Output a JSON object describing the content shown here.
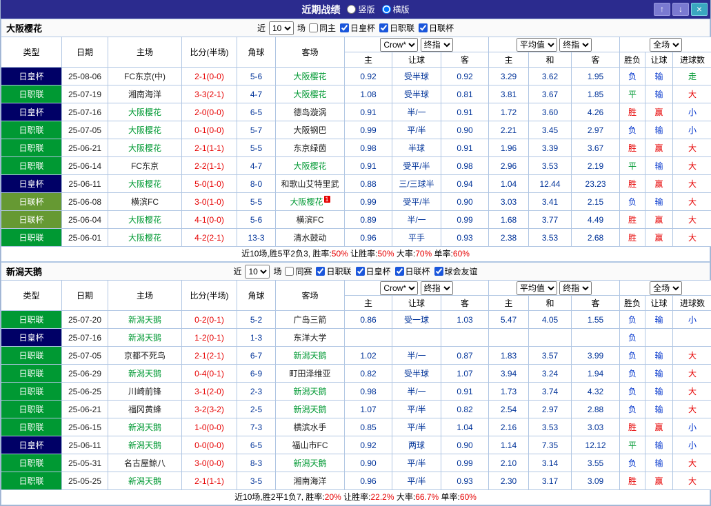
{
  "topbar": {
    "title": "近期战绩",
    "vertical_label": "竖版",
    "horizontal_label": "横版",
    "selected_layout": "横版",
    "up_icon": "↑",
    "down_icon": "↓",
    "close_icon": "×",
    "colors": {
      "bar_bg": "#2b2b8e",
      "button_bg": "#7a7ad1",
      "close_bg": "#3aa7c0"
    }
  },
  "labels": {
    "recent": "近",
    "matches": "场"
  },
  "table": {
    "col_type": "类型",
    "col_date": "日期",
    "col_home": "主场",
    "col_score": "比分(半场)",
    "col_corner": "角球",
    "col_away": "客场",
    "odds_company": "Crow*",
    "odds_final": "终指",
    "avg_label": "平均值",
    "avg_final": "终指",
    "scope": "全场",
    "sub": [
      "主",
      "让球",
      "客",
      "主",
      "和",
      "客",
      "胜负",
      "让球",
      "进球数"
    ]
  },
  "legend_colors": {
    "win": "#e60000",
    "draw": "#009933",
    "lose": "#0033cc",
    "league_j1": "#009933",
    "league_emperor": "#000066",
    "league_levain": "#669933",
    "focal_team": "#009933"
  },
  "sections": [
    {
      "team": "大阪樱花",
      "recent_count": "10",
      "checkboxes": [
        {
          "label": "同主",
          "checked": false
        },
        {
          "label": "日皇杯",
          "checked": true
        },
        {
          "label": "日职联",
          "checked": true
        },
        {
          "label": "日联杯",
          "checked": true
        }
      ],
      "rows": [
        {
          "league": "日皇杯",
          "date": "25-08-06",
          "home": "FC东京(中)",
          "home_focal": false,
          "score": "2-1(0-0)",
          "corner": "5-6",
          "away": "大阪樱花",
          "away_focal": true,
          "away_badge": "",
          "odds": [
            "0.92",
            "受半球",
            "0.92"
          ],
          "avg": [
            "3.29",
            "3.62",
            "1.95"
          ],
          "result": "负",
          "handicap_result": "输",
          "goals_result": "走"
        },
        {
          "league": "日职联",
          "date": "25-07-19",
          "home": "湘南海洋",
          "home_focal": false,
          "score": "3-3(2-1)",
          "corner": "4-7",
          "away": "大阪樱花",
          "away_focal": true,
          "away_badge": "",
          "odds": [
            "1.08",
            "受半球",
            "0.81"
          ],
          "avg": [
            "3.81",
            "3.67",
            "1.85"
          ],
          "result": "平",
          "handicap_result": "输",
          "goals_result": "大"
        },
        {
          "league": "日皇杯",
          "date": "25-07-16",
          "home": "大阪樱花",
          "home_focal": true,
          "score": "2-0(0-0)",
          "corner": "6-5",
          "away": "德岛漩涡",
          "away_focal": false,
          "away_badge": "",
          "odds": [
            "0.91",
            "半/一",
            "0.91"
          ],
          "avg": [
            "1.72",
            "3.60",
            "4.26"
          ],
          "result": "胜",
          "handicap_result": "赢",
          "goals_result": "小"
        },
        {
          "league": "日职联",
          "date": "25-07-05",
          "home": "大阪樱花",
          "home_focal": true,
          "score": "0-1(0-0)",
          "corner": "5-7",
          "away": "大阪钢巴",
          "away_focal": false,
          "away_badge": "",
          "odds": [
            "0.99",
            "平/半",
            "0.90"
          ],
          "avg": [
            "2.21",
            "3.45",
            "2.97"
          ],
          "result": "负",
          "handicap_result": "输",
          "goals_result": "小"
        },
        {
          "league": "日职联",
          "date": "25-06-21",
          "home": "大阪樱花",
          "home_focal": true,
          "score": "2-1(1-1)",
          "corner": "5-5",
          "away": "东京绿茵",
          "away_focal": false,
          "away_badge": "",
          "odds": [
            "0.98",
            "半球",
            "0.91"
          ],
          "avg": [
            "1.96",
            "3.39",
            "3.67"
          ],
          "result": "胜",
          "handicap_result": "赢",
          "goals_result": "大"
        },
        {
          "league": "日职联",
          "date": "25-06-14",
          "home": "FC东京",
          "home_focal": false,
          "score": "2-2(1-1)",
          "corner": "4-7",
          "away": "大阪樱花",
          "away_focal": true,
          "away_badge": "",
          "odds": [
            "0.91",
            "受平/半",
            "0.98"
          ],
          "avg": [
            "2.96",
            "3.53",
            "2.19"
          ],
          "result": "平",
          "handicap_result": "输",
          "goals_result": "大"
        },
        {
          "league": "日皇杯",
          "date": "25-06-11",
          "home": "大阪樱花",
          "home_focal": true,
          "score": "5-0(1-0)",
          "corner": "8-0",
          "away": "和歌山艾特里武",
          "away_focal": false,
          "away_badge": "",
          "odds": [
            "0.88",
            "三/三球半",
            "0.94"
          ],
          "avg": [
            "1.04",
            "12.44",
            "23.23"
          ],
          "result": "胜",
          "handicap_result": "赢",
          "goals_result": "大"
        },
        {
          "league": "日联杯",
          "date": "25-06-08",
          "home": "横滨FC",
          "home_focal": false,
          "score": "3-0(1-0)",
          "corner": "5-5",
          "away": "大阪樱花",
          "away_focal": true,
          "away_badge": "1",
          "odds": [
            "0.99",
            "受平/半",
            "0.90"
          ],
          "avg": [
            "3.03",
            "3.41",
            "2.15"
          ],
          "result": "负",
          "handicap_result": "输",
          "goals_result": "大"
        },
        {
          "league": "日联杯",
          "date": "25-06-04",
          "home": "大阪樱花",
          "home_focal": true,
          "score": "4-1(0-0)",
          "corner": "5-6",
          "away": "横滨FC",
          "away_focal": false,
          "away_badge": "",
          "odds": [
            "0.89",
            "半/一",
            "0.99"
          ],
          "avg": [
            "1.68",
            "3.77",
            "4.49"
          ],
          "result": "胜",
          "handicap_result": "赢",
          "goals_result": "大"
        },
        {
          "league": "日职联",
          "date": "25-06-01",
          "home": "大阪樱花",
          "home_focal": true,
          "score": "4-2(2-1)",
          "corner": "13-3",
          "away": "清水鼓动",
          "away_focal": false,
          "away_badge": "",
          "odds": [
            "0.96",
            "平手",
            "0.93"
          ],
          "avg": [
            "2.38",
            "3.53",
            "2.68"
          ],
          "result": "胜",
          "handicap_result": "赢",
          "goals_result": "大"
        }
      ],
      "summary": [
        {
          "text": "近10场,胜5平2负3, 胜率:",
          "red": false
        },
        {
          "text": "50%",
          "red": true
        },
        {
          "text": " 让胜率:",
          "red": false
        },
        {
          "text": "50%",
          "red": true
        },
        {
          "text": " 大率:",
          "red": false
        },
        {
          "text": "70%",
          "red": true
        },
        {
          "text": " 单率:",
          "red": false
        },
        {
          "text": "60%",
          "red": true
        }
      ]
    },
    {
      "team": "新潟天鹅",
      "recent_count": "10",
      "checkboxes": [
        {
          "label": "同赛",
          "checked": false
        },
        {
          "label": "日职联",
          "checked": true
        },
        {
          "label": "日皇杯",
          "checked": true
        },
        {
          "label": "日联杯",
          "checked": true
        },
        {
          "label": "球会友谊",
          "checked": true
        }
      ],
      "rows": [
        {
          "league": "日职联",
          "date": "25-07-20",
          "home": "新潟天鹅",
          "home_focal": true,
          "score": "0-2(0-1)",
          "corner": "5-2",
          "away": "广岛三箭",
          "away_focal": false,
          "away_badge": "",
          "odds": [
            "0.86",
            "受一球",
            "1.03"
          ],
          "avg": [
            "5.47",
            "4.05",
            "1.55"
          ],
          "result": "负",
          "handicap_result": "输",
          "goals_result": "小"
        },
        {
          "league": "日皇杯",
          "date": "25-07-16",
          "home": "新潟天鹅",
          "home_focal": true,
          "score": "1-2(0-1)",
          "corner": "1-3",
          "away": "东洋大学",
          "away_focal": false,
          "away_badge": "",
          "odds": [
            "",
            "",
            ""
          ],
          "avg": [
            "",
            "",
            ""
          ],
          "result": "负",
          "handicap_result": "",
          "goals_result": ""
        },
        {
          "league": "日职联",
          "date": "25-07-05",
          "home": "京都不死鸟",
          "home_focal": false,
          "score": "2-1(2-1)",
          "corner": "6-7",
          "away": "新潟天鹅",
          "away_focal": true,
          "away_badge": "",
          "odds": [
            "1.02",
            "半/一",
            "0.87"
          ],
          "avg": [
            "1.83",
            "3.57",
            "3.99"
          ],
          "result": "负",
          "handicap_result": "输",
          "goals_result": "大"
        },
        {
          "league": "日职联",
          "date": "25-06-29",
          "home": "新潟天鹅",
          "home_focal": true,
          "score": "0-4(0-1)",
          "corner": "6-9",
          "away": "町田泽维亚",
          "away_focal": false,
          "away_badge": "",
          "odds": [
            "0.82",
            "受半球",
            "1.07"
          ],
          "avg": [
            "3.94",
            "3.24",
            "1.94"
          ],
          "result": "负",
          "handicap_result": "输",
          "goals_result": "大"
        },
        {
          "league": "日职联",
          "date": "25-06-25",
          "home": "川崎前锋",
          "home_focal": false,
          "score": "3-1(2-0)",
          "corner": "2-3",
          "away": "新潟天鹅",
          "away_focal": true,
          "away_badge": "",
          "odds": [
            "0.98",
            "半/一",
            "0.91"
          ],
          "avg": [
            "1.73",
            "3.74",
            "4.32"
          ],
          "result": "负",
          "handicap_result": "输",
          "goals_result": "大"
        },
        {
          "league": "日职联",
          "date": "25-06-21",
          "home": "福冈黄蜂",
          "home_focal": false,
          "score": "3-2(3-2)",
          "corner": "2-5",
          "away": "新潟天鹅",
          "away_focal": true,
          "away_badge": "",
          "odds": [
            "1.07",
            "平/半",
            "0.82"
          ],
          "avg": [
            "2.54",
            "2.97",
            "2.88"
          ],
          "result": "负",
          "handicap_result": "输",
          "goals_result": "大"
        },
        {
          "league": "日职联",
          "date": "25-06-15",
          "home": "新潟天鹅",
          "home_focal": true,
          "score": "1-0(0-0)",
          "corner": "7-3",
          "away": "横滨水手",
          "away_focal": false,
          "away_badge": "",
          "odds": [
            "0.85",
            "平/半",
            "1.04"
          ],
          "avg": [
            "2.16",
            "3.53",
            "3.03"
          ],
          "result": "胜",
          "handicap_result": "赢",
          "goals_result": "小"
        },
        {
          "league": "日皇杯",
          "date": "25-06-11",
          "home": "新潟天鹅",
          "home_focal": true,
          "score": "0-0(0-0)",
          "corner": "6-5",
          "away": "福山市FC",
          "away_focal": false,
          "away_badge": "",
          "odds": [
            "0.92",
            "两球",
            "0.90"
          ],
          "avg": [
            "1.14",
            "7.35",
            "12.12"
          ],
          "result": "平",
          "handicap_result": "输",
          "goals_result": "小"
        },
        {
          "league": "日职联",
          "date": "25-05-31",
          "home": "名古屋鲸八",
          "home_focal": false,
          "score": "3-0(0-0)",
          "corner": "8-3",
          "away": "新潟天鹅",
          "away_focal": true,
          "away_badge": "",
          "odds": [
            "0.90",
            "平/半",
            "0.99"
          ],
          "avg": [
            "2.10",
            "3.14",
            "3.55"
          ],
          "result": "负",
          "handicap_result": "输",
          "goals_result": "大"
        },
        {
          "league": "日职联",
          "date": "25-05-25",
          "home": "新潟天鹅",
          "home_focal": true,
          "score": "2-1(1-1)",
          "corner": "3-5",
          "away": "湘南海洋",
          "away_focal": false,
          "away_badge": "",
          "odds": [
            "0.96",
            "平/半",
            "0.93"
          ],
          "avg": [
            "2.30",
            "3.17",
            "3.09"
          ],
          "result": "胜",
          "handicap_result": "赢",
          "goals_result": "大"
        }
      ],
      "summary": [
        {
          "text": "近10场,胜2平1负7, 胜率:",
          "red": false
        },
        {
          "text": "20%",
          "red": true
        },
        {
          "text": " 让胜率:",
          "red": false
        },
        {
          "text": "22.2%",
          "red": true
        },
        {
          "text": " 大率:",
          "red": false
        },
        {
          "text": "66.7%",
          "red": true
        },
        {
          "text": " 单率:",
          "red": false
        },
        {
          "text": "60%",
          "red": true
        }
      ]
    }
  ]
}
